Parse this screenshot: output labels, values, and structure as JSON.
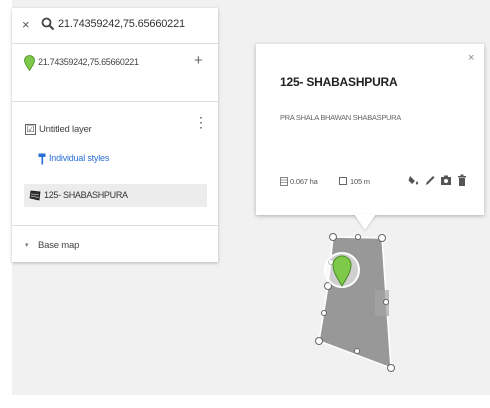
{
  "search": {
    "close_label": "×",
    "query": "21.74359242,75.65660221",
    "icon": "search-icon"
  },
  "place": {
    "label": "21.74359242,75.65660221",
    "add_label": "+",
    "pin_color": "#7ec84a"
  },
  "layer": {
    "name": "Untitled layer",
    "checked": "☑",
    "menu_label": "⋮",
    "styles_label": "Individual styles",
    "feature_label": "125- SHABASHPURA"
  },
  "basemap": {
    "arrow": "▾",
    "label": "Base map"
  },
  "popup": {
    "close_label": "×",
    "title": "125- SHABASHPURA",
    "description": "PRA SHALA BHAWAN SHABASPURA",
    "area": "0.067 ha",
    "perimeter": "105 m",
    "tools": [
      "style-icon",
      "edit-icon",
      "camera-icon",
      "delete-icon"
    ]
  },
  "colors": {
    "accent_link": "#2a6fd6",
    "polygon_fill": "#8e8e8e",
    "marker_green": "#7ec84a"
  }
}
